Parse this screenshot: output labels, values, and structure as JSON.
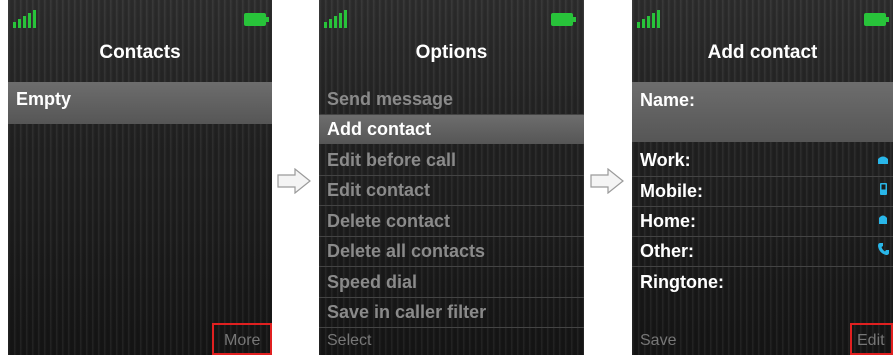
{
  "screens": [
    {
      "title": "Contacts",
      "items": [
        "Empty"
      ],
      "softkey_right": "More",
      "battery_color": "#28c33a",
      "signal_color": "#28c33a"
    },
    {
      "title": "Options",
      "menu": [
        {
          "label": "Send message",
          "state": "disabled"
        },
        {
          "label": "Add contact",
          "state": "selected"
        },
        {
          "label": "Edit before call",
          "state": "disabled"
        },
        {
          "label": "Edit contact",
          "state": "disabled"
        },
        {
          "label": "Delete contact",
          "state": "disabled"
        },
        {
          "label": "Delete all contacts",
          "state": "disabled"
        },
        {
          "label": "Speed dial",
          "state": "disabled"
        },
        {
          "label": "Save in caller filter",
          "state": "disabled"
        }
      ],
      "softkey_left": "Select"
    },
    {
      "title": "Add contact",
      "fields": [
        {
          "label": "Name:",
          "icon": null
        },
        {
          "label": "Work:",
          "icon": "work-phone-icon"
        },
        {
          "label": "Mobile:",
          "icon": "mobile-phone-icon"
        },
        {
          "label": "Home:",
          "icon": "home-phone-icon"
        },
        {
          "label": "Other:",
          "icon": "other-phone-icon"
        },
        {
          "label": "Ringtone:",
          "icon": null
        }
      ],
      "softkey_left": "Save",
      "softkey_right": "Edit",
      "icon_color": "#29b6e8"
    }
  ],
  "highlight_color": "#e02020"
}
